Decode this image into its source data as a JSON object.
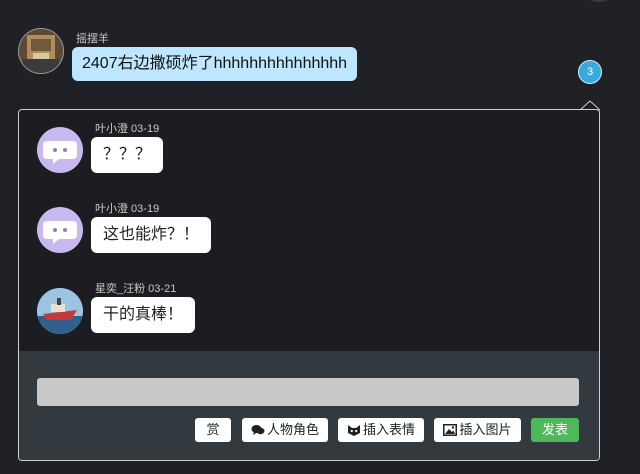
{
  "post": {
    "username": "摇摆羊",
    "message": "2407右边撒硕炸了hhhhhhhhhhhhhhh",
    "reply_count": "3"
  },
  "replies": [
    {
      "author_date": "叶小澄 03-19",
      "text": "？？？",
      "avatar_icon": "speech-bubble-face-icon"
    },
    {
      "author_date": "叶小澄 03-19",
      "text": "这也能炸？！",
      "avatar_icon": "speech-bubble-face-icon"
    },
    {
      "author_date": "星奕_汪粉 03-21",
      "text": "干的真棒！",
      "avatar_icon": "ship-photo-avatar"
    }
  ],
  "composer": {
    "input_value": "",
    "buttons": {
      "reward": "赏",
      "character": "人物角色",
      "emoji": "插入表情",
      "image": "插入图片",
      "submit": "发表"
    }
  },
  "colors": {
    "page_bg": "#1f2126",
    "panel_bg": "#1c1d22",
    "composer_bg": "#333a3f",
    "bubble_blue": "#bfe6ff",
    "badge": "#3aa9dd",
    "avatar_purple": "#c8b8ee",
    "submit_green": "#4fb85a"
  }
}
